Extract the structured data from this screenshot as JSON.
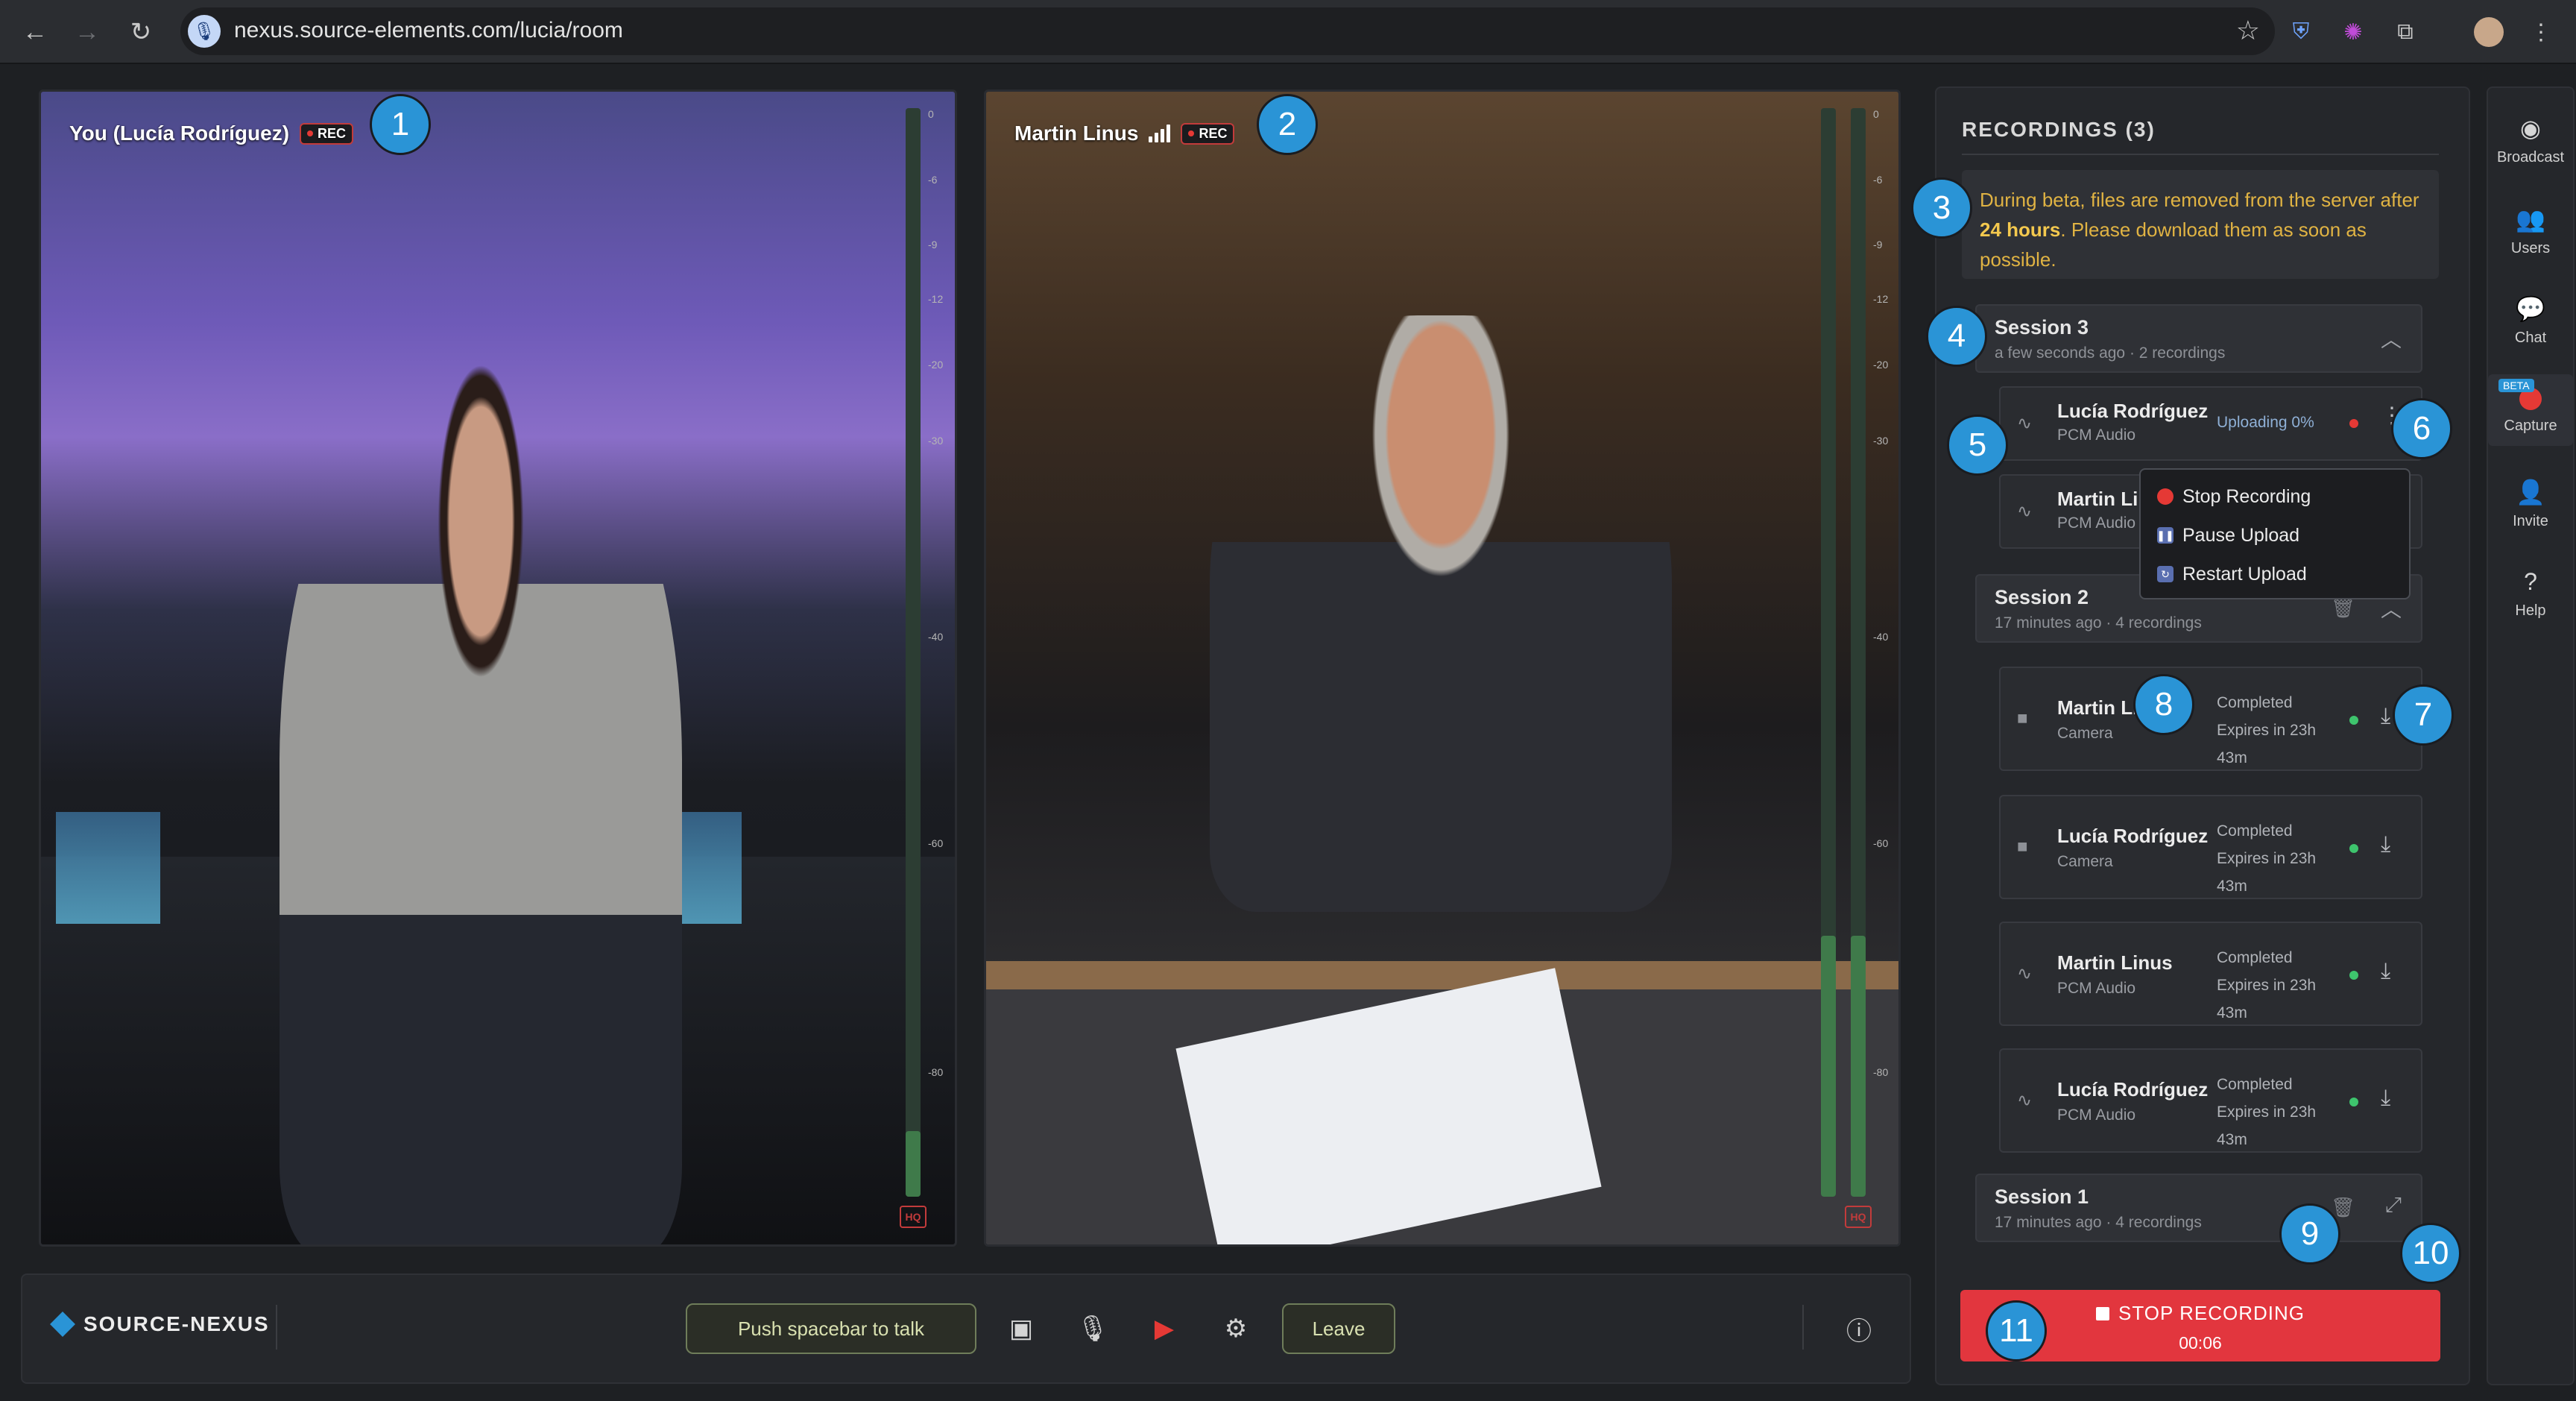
{
  "browser": {
    "url": "nexus.source-elements.com/lucia/room"
  },
  "videos": [
    {
      "label": "You (Lucía Rodríguez)",
      "rec_badge": "REC",
      "meter_ticks": [
        "0",
        "-6",
        "-9",
        "-12",
        "-20",
        "-30",
        "-40",
        "-60",
        "-80"
      ],
      "meter_level": 0.06,
      "hq": "HQ"
    },
    {
      "label": "Martin Linus",
      "rec_badge": "REC",
      "meter_ticks": [
        "0",
        "-6",
        "-9",
        "-12",
        "-20",
        "-30",
        "-40",
        "-60",
        "-80"
      ],
      "meter_level": 0.24,
      "hq": "HQ"
    }
  ],
  "callouts": [
    "1",
    "2",
    "3",
    "4",
    "5",
    "6",
    "7",
    "8",
    "9",
    "10",
    "11"
  ],
  "toolbar": {
    "brand": "SOURCE-NEXUS",
    "push_to_talk": "Push spacebar to talk",
    "leave": "Leave",
    "icons": [
      "chat-bubble-icon",
      "microphone-icon",
      "camera-off-icon",
      "settings-icon",
      "info-icon"
    ]
  },
  "recordings": {
    "title": "RECORDINGS (3)",
    "note_pre": "During beta, files are removed from the server after ",
    "note_bold": "24 hours",
    "note_post": ". Please download them as soon as possible.",
    "sessions": [
      {
        "title": "Session 3",
        "sub": "a few seconds ago · 2 recordings",
        "items": [
          {
            "name": "Lucía Rodríguez",
            "type": "PCM Audio",
            "status": "Uploading 0%"
          },
          {
            "name": "Martin Lin",
            "type": "PCM Audio"
          }
        ]
      },
      {
        "title": "Session 2",
        "sub": "17 minutes ago · 4 recordings",
        "items": [
          {
            "name": "Martin Lin",
            "type": "Camera",
            "status": "Completed",
            "expires": "Expires in 23h 43m"
          },
          {
            "name": "Lucía Rodríguez",
            "type": "Camera",
            "status": "Completed",
            "expires": "Expires in 23h 43m"
          },
          {
            "name": "Martin Linus",
            "type": "PCM Audio",
            "status": "Completed",
            "expires": "Expires in 23h 43m"
          },
          {
            "name": "Lucía Rodríguez",
            "type": "PCM Audio",
            "status": "Completed",
            "expires": "Expires in 23h 43m"
          }
        ]
      },
      {
        "title": "Session 1",
        "sub": "17 minutes ago · 4 recordings"
      }
    ],
    "menu": [
      "Stop Recording",
      "Pause Upload",
      "Restart Upload"
    ],
    "stop_label": "STOP RECORDING",
    "stop_time": "00:06"
  },
  "rail": [
    "Broadcast",
    "Users",
    "Chat",
    "Capture",
    "Invite",
    "Help"
  ],
  "rail_beta": "BETA",
  "colors": {
    "accent": "#2a94d6",
    "danger": "#e2363e",
    "warning": "#e0b343",
    "success": "#3ec46d"
  }
}
